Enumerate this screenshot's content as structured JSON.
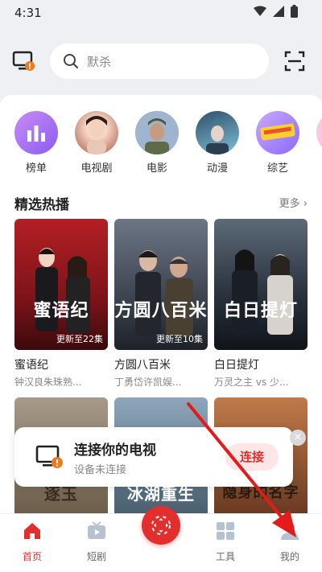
{
  "status": {
    "time": "4:31"
  },
  "search": {
    "placeholder": "默杀"
  },
  "categories": [
    {
      "label": "榜单"
    },
    {
      "label": "电视剧"
    },
    {
      "label": "电影"
    },
    {
      "label": "动漫"
    },
    {
      "label": "综艺"
    }
  ],
  "section": {
    "title": "精选热播",
    "more": "更多"
  },
  "cards": [
    {
      "title": "蜜语纪",
      "sub": "钟汉良朱珠熟...",
      "badge": "更新至22集",
      "poster_text": "蜜语纪"
    },
    {
      "title": "方圆八百米",
      "sub": "丁勇岱许凯娱...",
      "badge": "更新至10集",
      "poster_text": "方圆八百米"
    },
    {
      "title": "白日提灯",
      "sub": "万灵之主 vs 少...",
      "badge": "",
      "poster_text": "白日提灯"
    }
  ],
  "second_row": [
    {
      "poster_text": "逐玉"
    },
    {
      "poster_text": "冰湖重生"
    },
    {
      "poster_text": "隐身的名字"
    }
  ],
  "popup": {
    "title": "连接你的电视",
    "subtitle": "设备未连接",
    "connect": "连接",
    "close": "×"
  },
  "nav": [
    {
      "label": "首页"
    },
    {
      "label": "短剧"
    },
    {
      "label": ""
    },
    {
      "label": "工具"
    },
    {
      "label": "我的"
    }
  ],
  "colors": {
    "accent": "#e32e2e",
    "background": "#eef0f4"
  }
}
